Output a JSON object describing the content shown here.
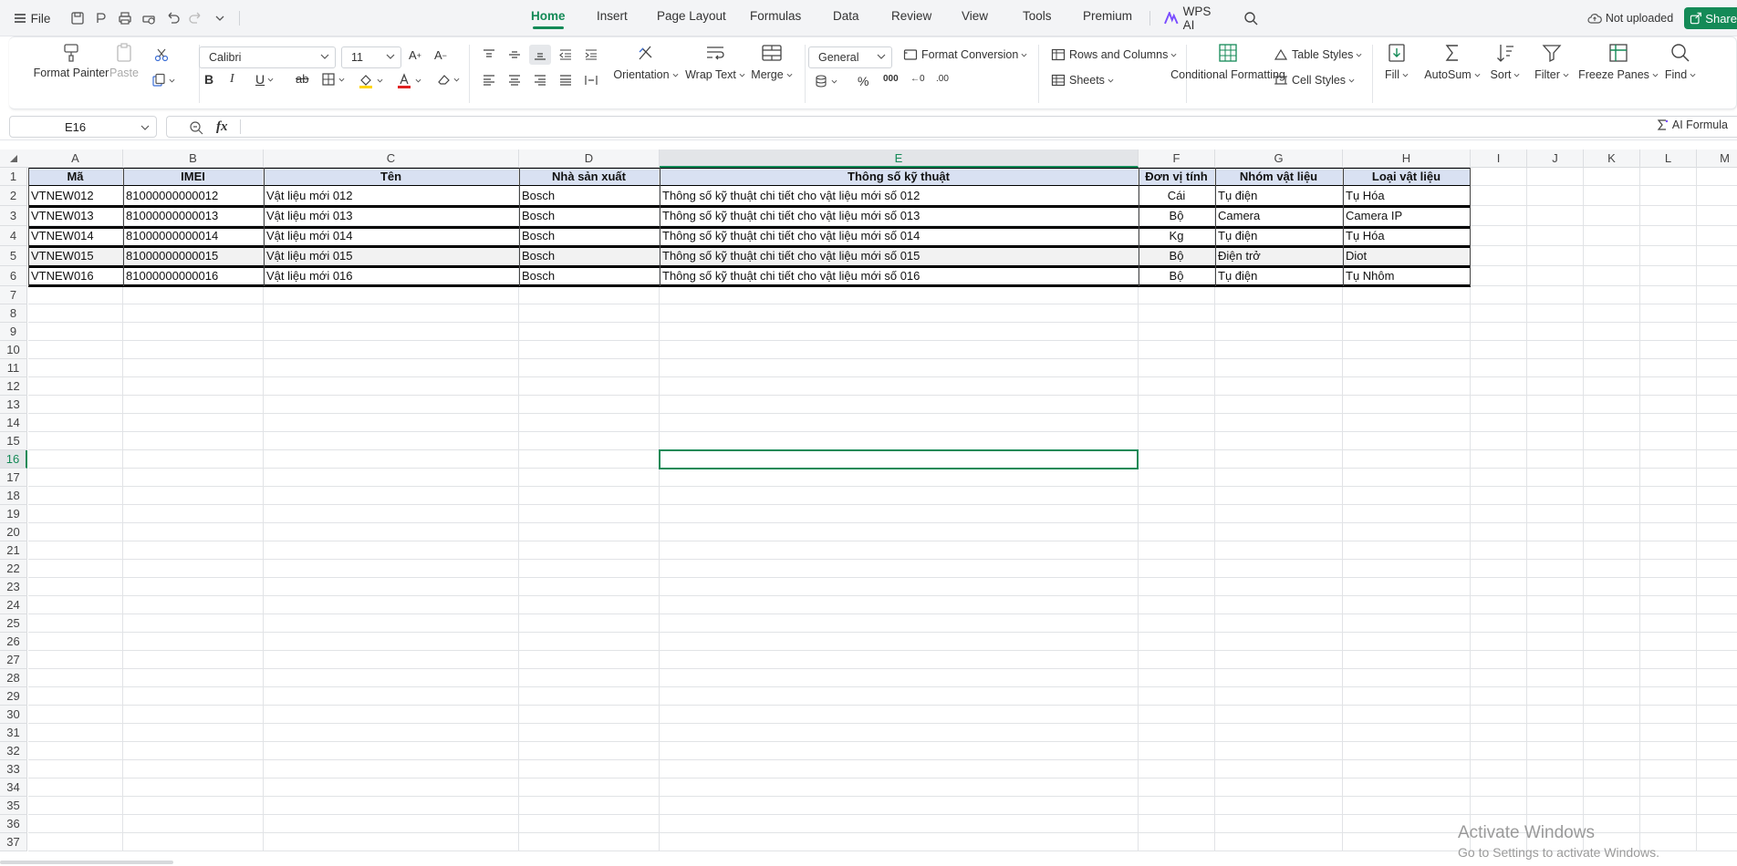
{
  "topbar": {
    "file_label": "File",
    "tabs": [
      "Home",
      "Insert",
      "Page Layout",
      "Formulas",
      "Data",
      "Review",
      "View",
      "Tools",
      "Premium"
    ],
    "active_tab": "Home",
    "wps_ai": "WPS AI",
    "cloud_status": "Not uploaded",
    "share": "Share"
  },
  "ribbon": {
    "format_painter": "Format Painter",
    "paste": "Paste",
    "font_name": "Calibri",
    "font_size": "11",
    "orientation": "Orientation",
    "wrap_text": "Wrap Text",
    "merge": "Merge",
    "number_format": "General",
    "format_conversion": "Format Conversion",
    "rows_and_columns": "Rows and Columns",
    "sheets": "Sheets",
    "conditional_formatting": "Conditional Formatting",
    "table_styles": "Table Styles",
    "cell_styles": "Cell Styles",
    "fill": "Fill",
    "autosum": "AutoSum",
    "sort": "Sort",
    "filter": "Filter",
    "freeze_panes": "Freeze Panes",
    "find": "Find",
    "font_color": "#e02020",
    "fill_color": "#ffd500",
    "accent": "#148a57"
  },
  "formula_bar": {
    "name_box": "E16",
    "fx": "fx",
    "formula": "",
    "ai_formula": "AI Formula"
  },
  "sheet": {
    "columns": [
      "A",
      "B",
      "C",
      "D",
      "E",
      "F",
      "G",
      "H",
      "I",
      "J",
      "K",
      "L",
      "M"
    ],
    "selected_column": "E",
    "selected_row": "16",
    "row_numbers": [
      "1",
      "2",
      "3",
      "4",
      "5",
      "6",
      "7",
      "8",
      "9",
      "10",
      "11",
      "12",
      "13",
      "14",
      "15",
      "16",
      "17",
      "18",
      "19",
      "20",
      "21",
      "22",
      "23",
      "24",
      "25",
      "26",
      "27",
      "28",
      "29",
      "30",
      "31",
      "32",
      "33",
      "34",
      "35",
      "36",
      "37"
    ],
    "header": [
      "Mã",
      "IMEI",
      "Tên",
      "Nhà sản xuất",
      "Thông số kỹ thuật",
      "Đơn vị tính",
      "Nhóm vật liệu",
      "Loại vật liệu"
    ],
    "rows": [
      [
        "VTNEW012",
        "81000000000012",
        "Vật liệu mới 012",
        "Bosch",
        "Thông số kỹ thuật chi tiết cho vật liệu mới số 012",
        "Cái",
        "Tụ điện",
        "Tụ Hóa"
      ],
      [
        "VTNEW013",
        "81000000000013",
        "Vật liệu mới 013",
        "Bosch",
        "Thông số kỹ thuật chi tiết cho vật liệu mới số 013",
        "Bộ",
        "Camera",
        "Camera IP"
      ],
      [
        "VTNEW014",
        "81000000000014",
        "Vật liệu mới 014",
        "Bosch",
        "Thông số kỹ thuật chi tiết cho vật liệu mới số 014",
        "Kg",
        "Tụ điện",
        "Tụ Hóa"
      ],
      [
        "VTNEW015",
        "81000000000015",
        "Vật liệu mới 015",
        "Bosch",
        "Thông số kỹ thuật chi tiết cho vật liệu mới số 015",
        "Bộ",
        "Điện trở",
        "Diot"
      ],
      [
        "VTNEW016",
        "81000000000016",
        "Vật liệu mới 016",
        "Bosch",
        "Thông số kỹ thuật chi tiết cho vật liệu mới số 016",
        "Bộ",
        "Tụ điện",
        "Tụ Nhôm"
      ]
    ]
  },
  "watermark": {
    "line1": "Activate Windows",
    "line2": "Go to Settings to activate Windows."
  }
}
